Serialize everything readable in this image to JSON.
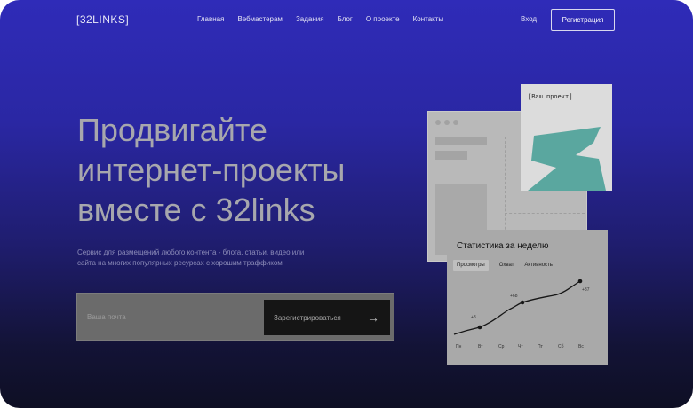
{
  "header": {
    "logo": "[32LINKS]",
    "nav": [
      "Главная",
      "Вебмастерам",
      "Задания",
      "Блог",
      "О проекте",
      "Контакты"
    ],
    "login_label": "Вход",
    "register_label": "Регистрация"
  },
  "hero": {
    "title_lines": [
      "Продвигайте",
      "интернет-проекты",
      "вместе с 32links"
    ],
    "subtitle_lines": [
      "Сервис для размещений любого контента - блога, статьи, видео или",
      "сайта на многих популярных ресурсах с хорошим траффиком"
    ],
    "email_placeholder": "Ваша почта",
    "submit_label": "Зарегистрироваться",
    "submit_icon": "arrow-right-icon"
  },
  "project_card": {
    "label": "[Ваш проект]",
    "accent_color": "#5aa79f"
  },
  "stats_card": {
    "title": "Статистика за неделю",
    "tabs": [
      "Просмотры",
      "Охват",
      "Активность"
    ],
    "active_tab": "Просмотры",
    "days": [
      "Пн",
      "Вт",
      "Ср",
      "Чт",
      "Пт",
      "Сб",
      "Вс"
    ],
    "point_labels": [
      "+8",
      "+68",
      "+87"
    ]
  },
  "colors": {
    "bg_top": "#2f2bb8",
    "bg_bottom": "#0e0f24",
    "teal": "#5aa79f"
  }
}
